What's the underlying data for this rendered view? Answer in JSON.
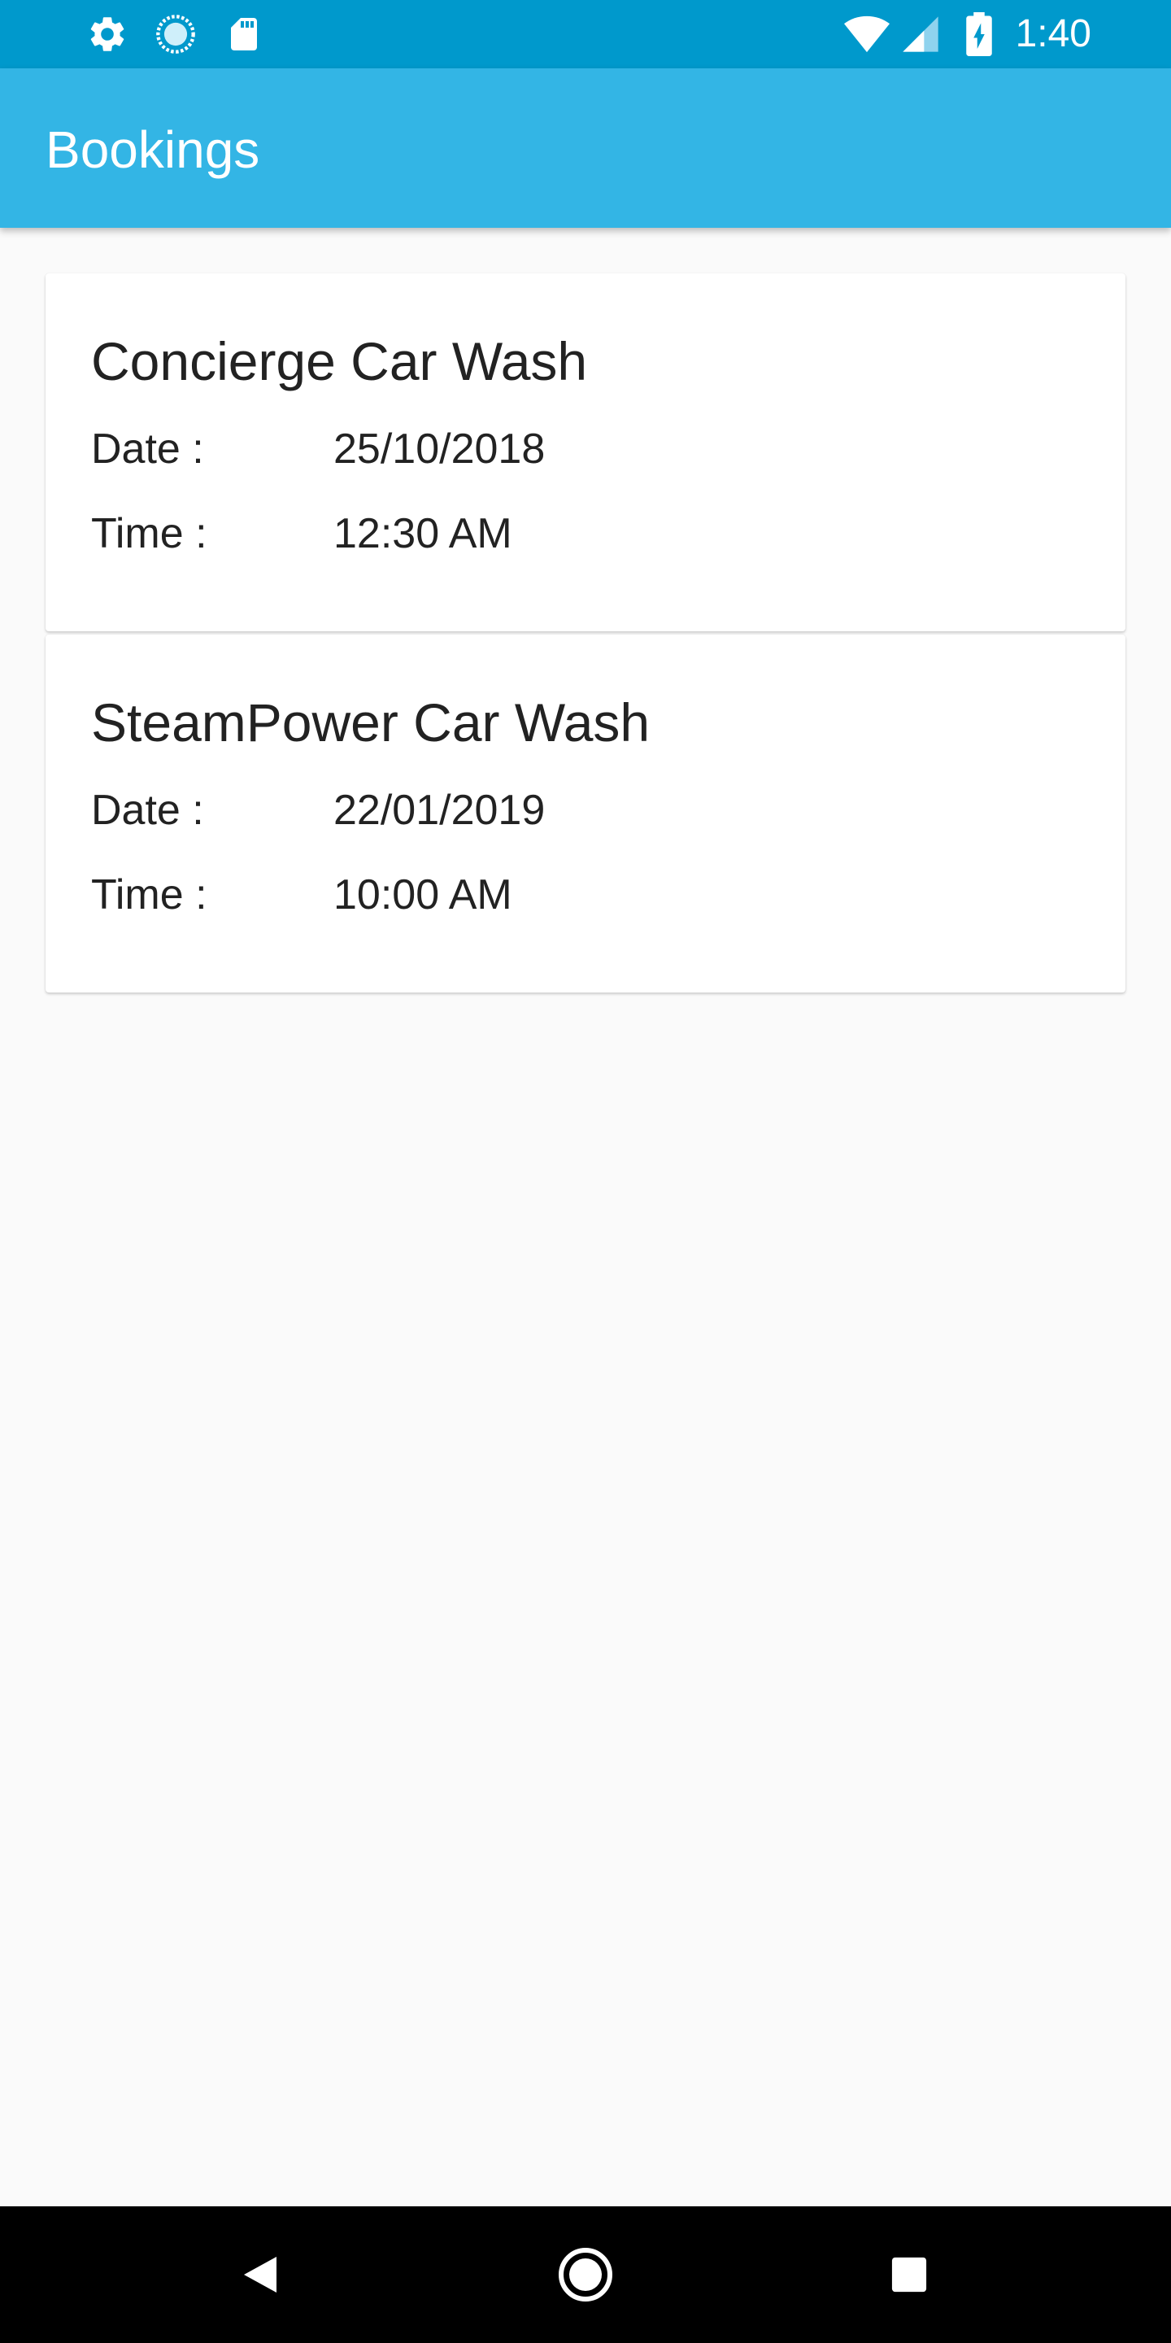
{
  "status_bar": {
    "time": "1:40",
    "icons": [
      "gear-icon",
      "sync-icon",
      "sd-card-icon",
      "wifi-icon",
      "signal-icon",
      "battery-icon"
    ],
    "background": "#0099cc"
  },
  "app_bar": {
    "title": "Bookings",
    "background": "#33b5e5"
  },
  "bookings": [
    {
      "name": "Concierge Car Wash",
      "date_label": "Date :",
      "date": "25/10/2018",
      "time_label": "Time :",
      "time": "12:30 AM"
    },
    {
      "name": "SteamPower Car Wash",
      "date_label": "Date :",
      "date": "22/01/2019",
      "time_label": "Time :",
      "time": "10:00 AM"
    }
  ],
  "nav_bar": {
    "buttons": [
      "back-icon",
      "home-icon",
      "recents-icon"
    ]
  }
}
